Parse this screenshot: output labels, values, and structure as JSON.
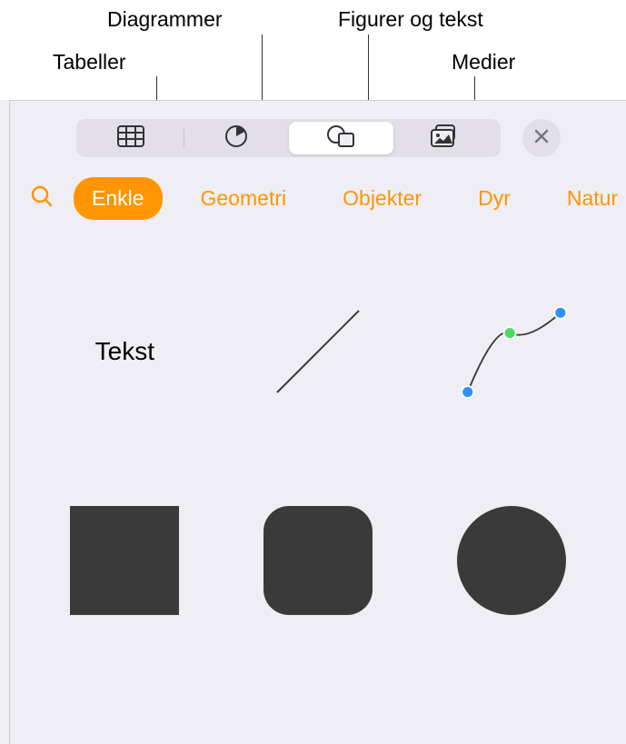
{
  "callouts": {
    "tables": "Tabeller",
    "diagrams": "Diagrammer",
    "shapes_text": "Figurer og tekst",
    "media": "Medier"
  },
  "toolbar": {
    "tables_icon": "table-icon",
    "diagrams_icon": "pie-chart-icon",
    "shapes_icon": "shapes-icon",
    "media_icon": "media-icon",
    "close_icon": "close-icon"
  },
  "categories": {
    "items": [
      {
        "label": "Enkle",
        "active": true
      },
      {
        "label": "Geometri",
        "active": false
      },
      {
        "label": "Objekter",
        "active": false
      },
      {
        "label": "Dyr",
        "active": false
      },
      {
        "label": "Natur",
        "active": false
      }
    ]
  },
  "shapes": {
    "text_label": "Tekst"
  },
  "colors": {
    "accent": "#ff9500",
    "shape_fill": "#3a3a3a",
    "bezier_green": "#4cd964",
    "bezier_blue": "#2e91ff"
  }
}
